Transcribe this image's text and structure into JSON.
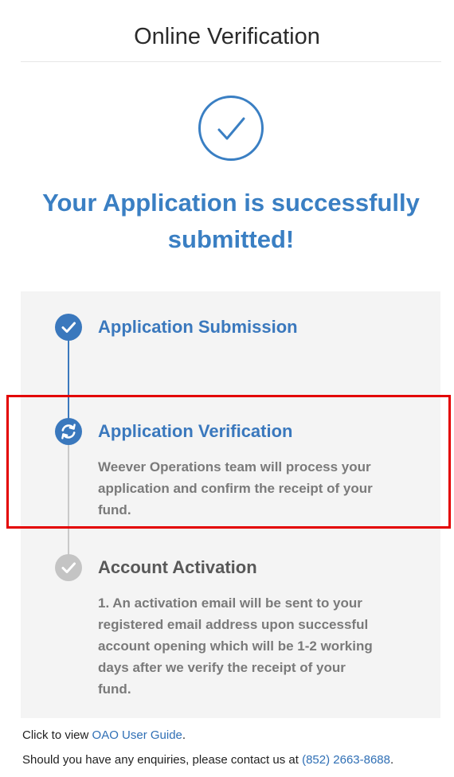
{
  "header": {
    "title": "Online Verification"
  },
  "status": {
    "headline_line1": "Your Application is successfully",
    "headline_line2": "submitted!",
    "icon": "check-circle-icon"
  },
  "steps": [
    {
      "title": "Application Submission",
      "state": "completed",
      "icon": "check-circle-filled-icon",
      "description": []
    },
    {
      "title": "Application Verification",
      "state": "in-progress",
      "icon": "refresh-circle-icon",
      "description": [
        "Weever Operations team will process your",
        "application and confirm the receipt of your",
        "fund."
      ]
    },
    {
      "title": "Account Activation",
      "state": "pending",
      "icon": "check-circle-gray-icon",
      "description": [
        "1. An activation email will be sent to your",
        "registered email address upon successful",
        "account opening which will be 1-2 working",
        "days after we verify the receipt of your",
        "fund."
      ]
    }
  ],
  "footer": {
    "guide_prefix": "Click to view ",
    "guide_link": "OAO User Guide",
    "guide_suffix": ".",
    "contact_prefix": "Should you have any enquiries, please contact us at ",
    "contact_phone": "(852) 2663-8688",
    "contact_suffix": "."
  },
  "colors": {
    "accent": "#3a78bd",
    "headline": "#3a7fc3",
    "pending": "#c4c4c4",
    "pending_text": "#585858",
    "highlight": "#e30000"
  }
}
